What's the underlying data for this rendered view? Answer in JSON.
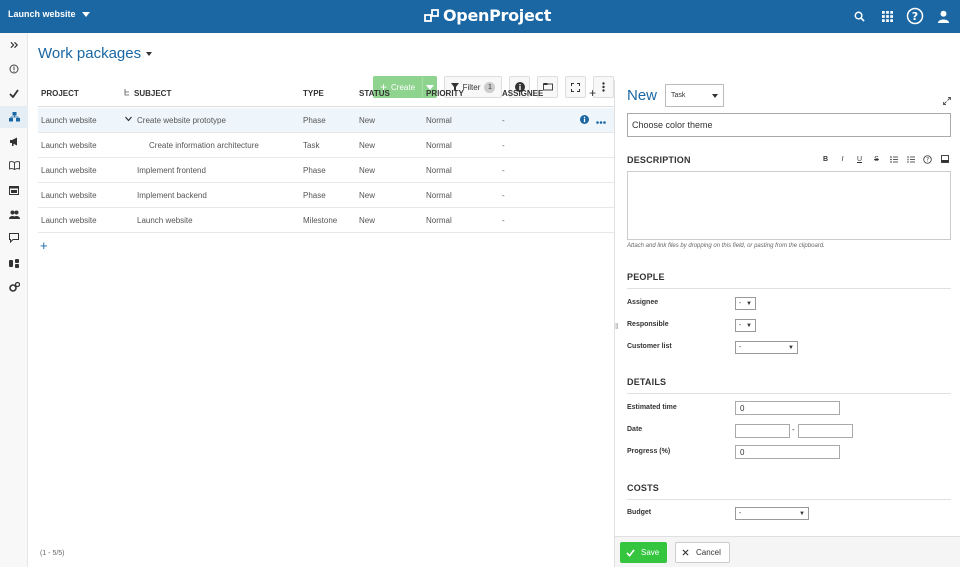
{
  "topbar": {
    "project_selector": "Launch website",
    "logo_text": "OpenProject",
    "icons": [
      "search-icon",
      "modules-grid-icon",
      "help-icon",
      "user-avatar-icon"
    ],
    "background": "#1a67a3"
  },
  "sidebar": {
    "items": [
      {
        "name": "toggle-sidebar-icon"
      },
      {
        "name": "overview-icon"
      },
      {
        "name": "activity-check-icon"
      },
      {
        "name": "work-packages-icon",
        "active": true
      },
      {
        "name": "news-icon"
      },
      {
        "name": "wiki-icon"
      },
      {
        "name": "calendar-icon"
      },
      {
        "name": "members-icon"
      },
      {
        "name": "forums-icon"
      },
      {
        "name": "budgets-icon"
      },
      {
        "name": "settings-icon"
      }
    ]
  },
  "main": {
    "title": "Work packages",
    "toolbar": {
      "create_label": "Create",
      "filter_label": "Filter",
      "filter_count": "1"
    },
    "columns": {
      "project": "PROJECT",
      "subject": "SUBJECT",
      "type": "TYPE",
      "status": "STATUS",
      "priority": "PRIORITY",
      "assignee": "ASSIGNEE",
      "add": "+"
    },
    "rows": [
      {
        "project": "Launch website",
        "subject": "Create website prototype",
        "type": "Phase",
        "status": "New",
        "priority": "Normal",
        "assignee": "-"
      },
      {
        "project": "Launch website",
        "subject": "Create information architecture",
        "type": "Task",
        "status": "New",
        "priority": "Normal",
        "assignee": "-"
      },
      {
        "project": "Launch website",
        "subject": "Implement frontend",
        "type": "Phase",
        "status": "New",
        "priority": "Normal",
        "assignee": "-"
      },
      {
        "project": "Launch website",
        "subject": "Implement backend",
        "type": "Phase",
        "status": "New",
        "priority": "Normal",
        "assignee": "-"
      },
      {
        "project": "Launch website",
        "subject": "Launch website",
        "type": "Milestone",
        "status": "New",
        "priority": "Normal",
        "assignee": "-"
      }
    ],
    "add_row": "+",
    "pagination": "(1 - 5/5)"
  },
  "panel": {
    "new_label": "New",
    "type_value": "Task",
    "subject_value": "Choose color theme",
    "description_heading": "DESCRIPTION",
    "rte_tools": [
      "B",
      "I",
      "U",
      "S"
    ],
    "attach_hint": "Attach and link files by dropping on this field, or pasting from the clipboard.",
    "people_heading": "PEOPLE",
    "assignee_label": "Assignee",
    "assignee_value": "-",
    "responsible_label": "Responsible",
    "responsible_value": "-",
    "customer_list_label": "Customer list",
    "customer_list_value": "-",
    "details_heading": "DETAILS",
    "estimated_time_label": "Estimated time",
    "estimated_time_value": "0",
    "date_label": "Date",
    "date_separator": "-",
    "progress_label": "Progress (%)",
    "progress_value": "0",
    "costs_heading": "COSTS",
    "budget_label": "Budget",
    "budget_value": "-",
    "save_label": "Save",
    "cancel_label": "Cancel"
  },
  "colors": {
    "accent": "#1a67a3",
    "create_button": "#8ed38e",
    "save_button": "#35c53f"
  }
}
